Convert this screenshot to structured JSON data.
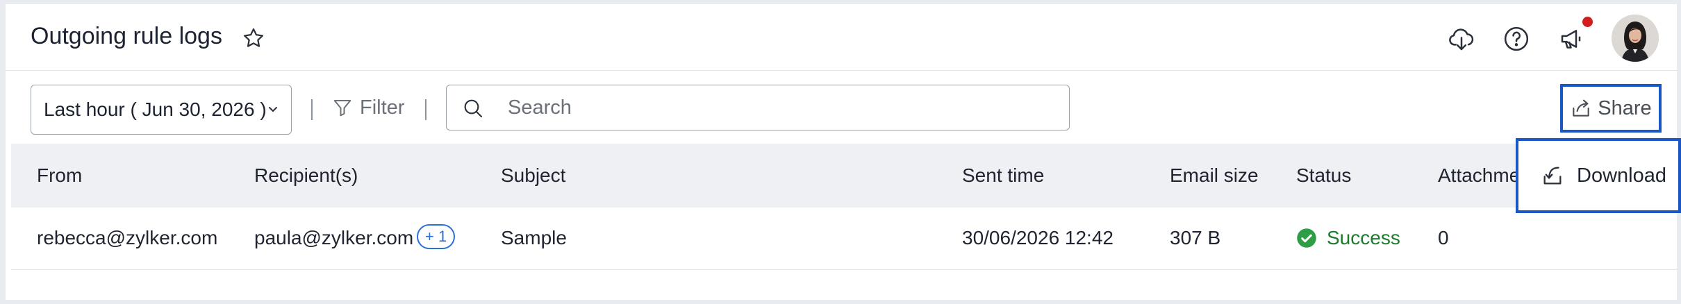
{
  "header": {
    "title": "Outgoing rule logs",
    "icons": [
      "star-icon",
      "cloud-download-icon",
      "help-icon",
      "announcement-icon",
      "avatar"
    ]
  },
  "toolbar": {
    "time_range": "Last hour ( Jun 30, 2026 )",
    "filter_label": "Filter",
    "search_placeholder": "Search",
    "share_label": "Share"
  },
  "table": {
    "columns": [
      "From",
      "Recipient(s)",
      "Subject",
      "Sent time",
      "Email size",
      "Status",
      "Attachme"
    ],
    "rows": [
      {
        "from": "rebecca@zylker.com",
        "recipients": "paula@zylker.com",
        "extra_recipients": "+ 1",
        "subject": "Sample",
        "sent_time": "30/06/2026 12:42",
        "size": "307 B",
        "status": "Success",
        "attachments": "0"
      }
    ]
  },
  "download_menu": {
    "label": "Download"
  },
  "colors": {
    "accent": "#1a56c4",
    "success": "#1d7a2e",
    "notification": "#d21e1e",
    "header_bg": "#eef0f3"
  }
}
